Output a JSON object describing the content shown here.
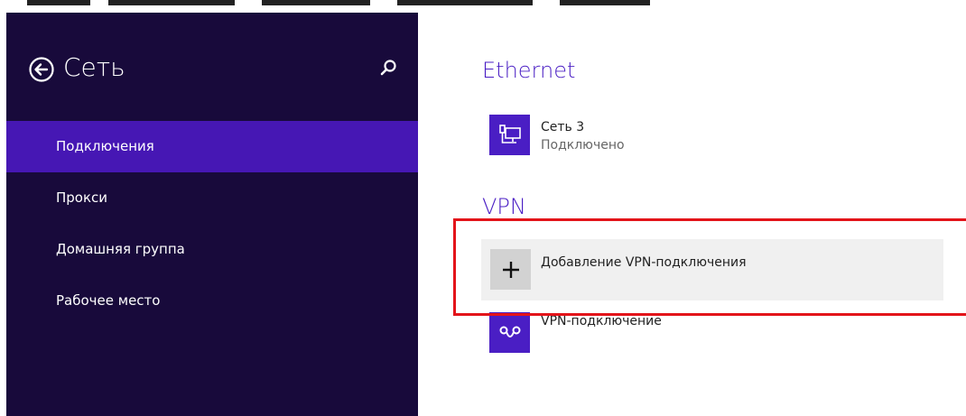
{
  "sidebar": {
    "title": "Сеть",
    "back_icon": "back-arrow-circle-icon",
    "search_icon": "search-icon",
    "items": [
      {
        "label": "Подключения",
        "selected": true
      },
      {
        "label": "Прокси",
        "selected": false
      },
      {
        "label": "Домашняя группа",
        "selected": false
      },
      {
        "label": "Рабочее место",
        "selected": false
      }
    ]
  },
  "main": {
    "ethernet": {
      "title": "Ethernet",
      "connection": {
        "name": "Сеть  3",
        "status": "Подключено",
        "icon": "ethernet-icon"
      }
    },
    "vpn": {
      "title": "VPN",
      "add_label": "Добавление VPN-подключения",
      "add_icon": "plus-icon",
      "connection": {
        "name": "VPN-подключение",
        "icon": "vpn-icon"
      }
    }
  },
  "colors": {
    "sidebar_bg": "#180a3b",
    "selected_bg": "#4617b4",
    "accent": "#4a1ec4",
    "highlight": "#e3141a"
  }
}
